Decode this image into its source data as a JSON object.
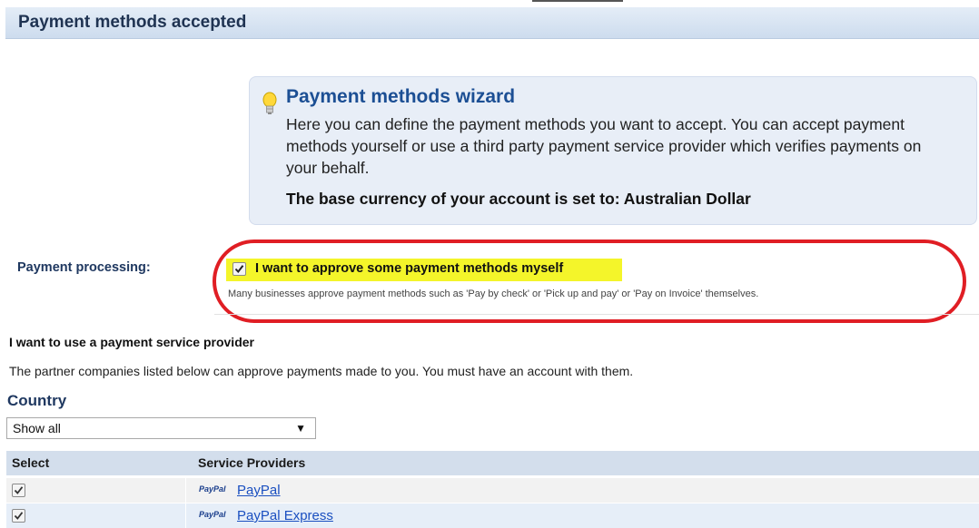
{
  "header": {
    "title": "Payment methods accepted"
  },
  "wizard": {
    "title": "Payment methods wizard",
    "text": "Here you can define the payment methods you want to accept. You can accept payment methods yourself or use a third party payment service provider which verifies payments on your behalf.",
    "currency": "The base currency of your account is set to: Australian Dollar"
  },
  "processing": {
    "label": "Payment processing:",
    "checkbox_label": "I want to approve some payment methods myself",
    "checked": true,
    "note": "Many businesses approve payment methods such as 'Pay by check' or 'Pick up and pay' or 'Pay on Invoice' themselves."
  },
  "psp": {
    "title": "I want to use a payment service provider",
    "text": "The partner companies listed below can approve payments made to you. You must have an account with them."
  },
  "country": {
    "label": "Country",
    "selected": "Show all",
    "arrow": "▼"
  },
  "table": {
    "headers": [
      "Select",
      "Service Providers"
    ],
    "rows": [
      {
        "logo": "PayPal",
        "name": "PayPal",
        "checked": true
      },
      {
        "logo": "PayPal",
        "name": "PayPal Express",
        "checked": true
      }
    ]
  },
  "colors": {
    "header_bg": "#cddcee",
    "wizard_bg": "#e8eef7",
    "highlight": "#f4f52a",
    "annotation_ring": "#e01e24",
    "link": "#1a4fc0"
  },
  "icons": {
    "wizard": "lightbulb-icon",
    "check": "checkmark-icon"
  }
}
